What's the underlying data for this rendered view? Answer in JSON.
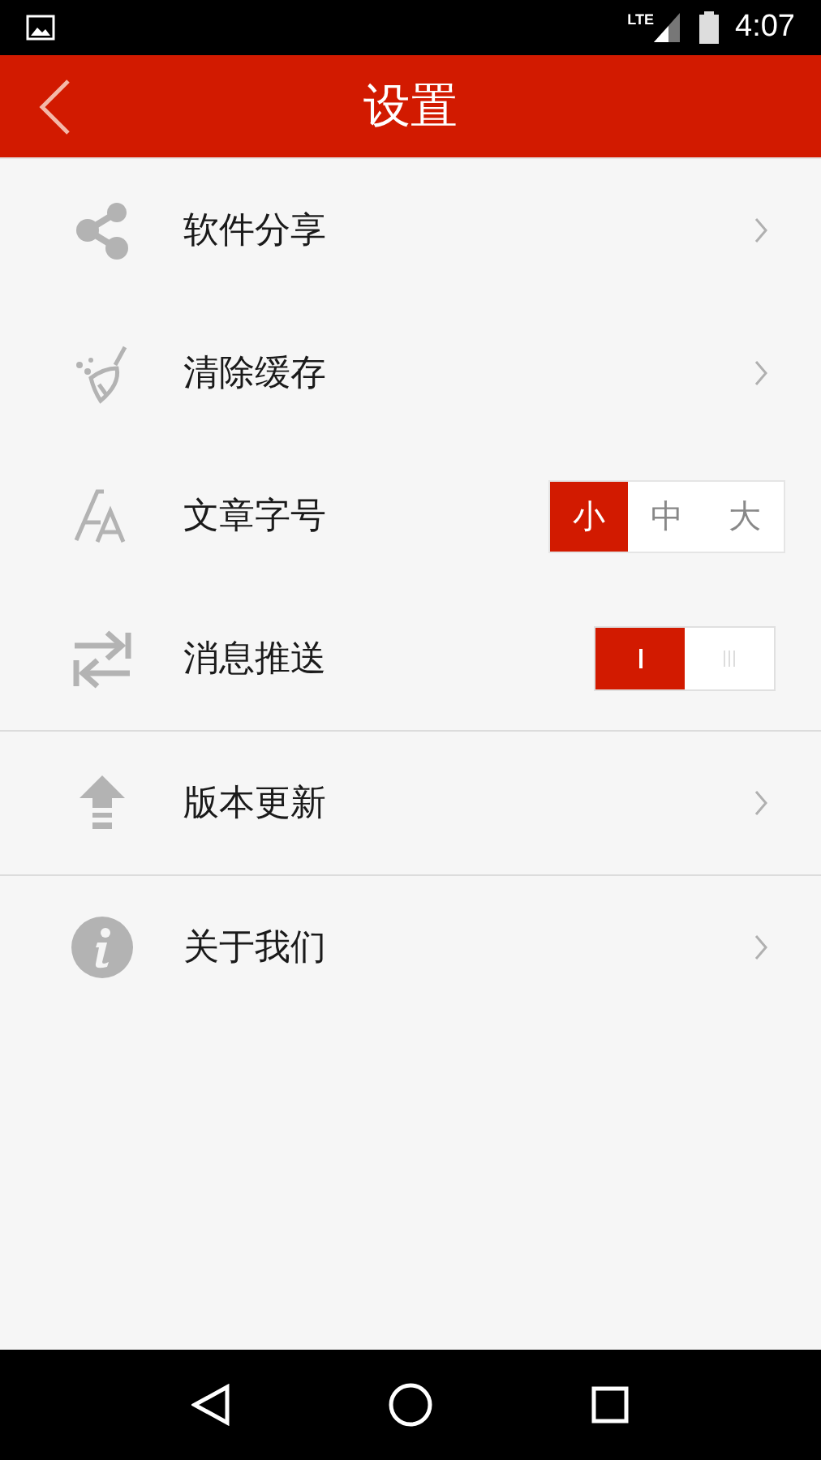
{
  "status_bar": {
    "time": "4:07",
    "network": "LTE"
  },
  "header": {
    "title": "设置"
  },
  "groups": [
    {
      "items": [
        {
          "kind": "link",
          "label": "软件分享"
        },
        {
          "kind": "link",
          "label": "清除缓存"
        },
        {
          "kind": "segmented",
          "label": "文章字号",
          "options": [
            {
              "label": "小",
              "selected": true
            },
            {
              "label": "中",
              "selected": false
            },
            {
              "label": "大",
              "selected": false
            }
          ]
        },
        {
          "kind": "toggle",
          "label": "消息推送",
          "on": true
        }
      ]
    },
    {
      "items": [
        {
          "kind": "link",
          "label": "版本更新"
        }
      ]
    },
    {
      "items": [
        {
          "kind": "link",
          "label": "关于我们"
        }
      ]
    }
  ]
}
